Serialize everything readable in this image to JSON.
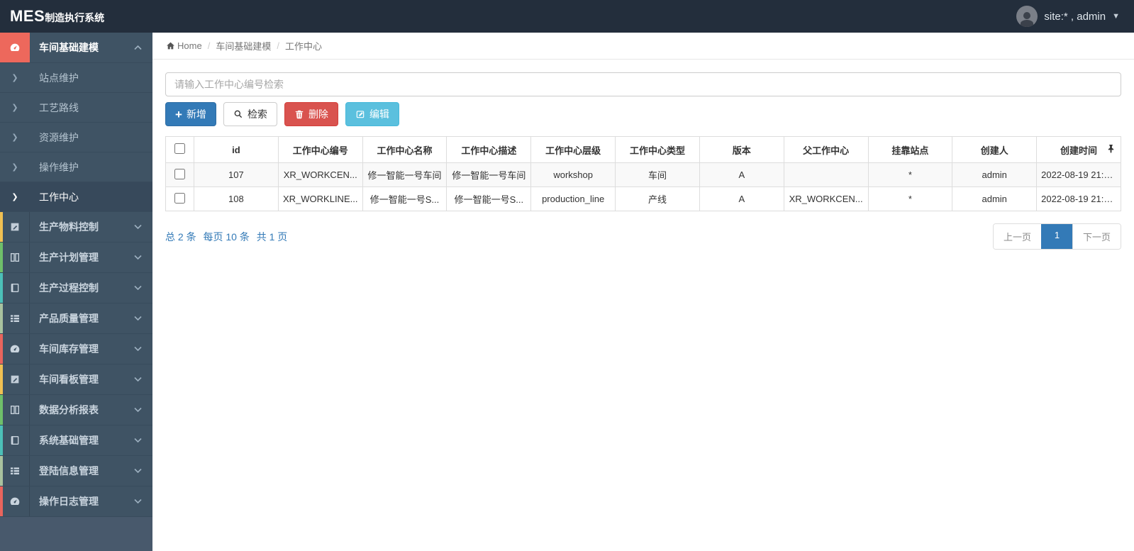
{
  "topbar": {
    "logo_mes": "MES",
    "logo_rest": "制造执行系统",
    "user_label": "site:* , admin"
  },
  "breadcrumb": {
    "home": "Home",
    "level1": "车间基础建模",
    "level2": "工作中心"
  },
  "sidebar": {
    "root": {
      "label": "车间基础建模",
      "icon": "dashboard-icon"
    },
    "sub_items": [
      {
        "label": "站点维护",
        "active": false
      },
      {
        "label": "工艺路线",
        "active": false
      },
      {
        "label": "资源维护",
        "active": false
      },
      {
        "label": "操作维护",
        "active": false
      },
      {
        "label": "工作中心",
        "active": true
      }
    ],
    "items": [
      {
        "label": "生产物料控制",
        "icon": "pencil-square-icon",
        "strip_color": "#f0c052"
      },
      {
        "label": "生产计划管理",
        "icon": "columns-icon",
        "strip_color": "#6fbf6a"
      },
      {
        "label": "生产过程控制",
        "icon": "book-icon",
        "strip_color": "#4cc0b8"
      },
      {
        "label": "产品质量管理",
        "icon": "th-list-icon",
        "strip_color": "#a9c29f"
      },
      {
        "label": "车间库存管理",
        "icon": "dashboard-icon",
        "strip_color": "#e9655d"
      },
      {
        "label": "车间看板管理",
        "icon": "pencil-square-icon",
        "strip_color": "#f0c052"
      },
      {
        "label": "数据分析报表",
        "icon": "columns-icon",
        "strip_color": "#6fbf6a"
      },
      {
        "label": "系统基础管理",
        "icon": "book-icon",
        "strip_color": "#4cc0b8"
      },
      {
        "label": "登陆信息管理",
        "icon": "th-list-icon",
        "strip_color": "#a9c29f"
      },
      {
        "label": "操作日志管理",
        "icon": "dashboard-icon",
        "strip_color": "#e9655d"
      }
    ]
  },
  "toolbar": {
    "search_placeholder": "请输入工作中心编号检索",
    "add_label": "新增",
    "search_label": "检索",
    "delete_label": "删除",
    "edit_label": "编辑"
  },
  "table": {
    "columns": [
      "id",
      "工作中心编号",
      "工作中心名称",
      "工作中心描述",
      "工作中心层级",
      "工作中心类型",
      "版本",
      "父工作中心",
      "挂靠站点",
      "创建人",
      "创建时间"
    ],
    "rows": [
      [
        "107",
        "XR_WORKCEN...",
        "修一智能一号车间",
        "修一智能一号车间",
        "workshop",
        "车间",
        "A",
        "",
        "*",
        "admin",
        "2022-08-19 21:1..."
      ],
      [
        "108",
        "XR_WORKLINE...",
        "修一智能一号S...",
        "修一智能一号S...",
        "production_line",
        "产线",
        "A",
        "XR_WORKCEN...",
        "*",
        "admin",
        "2022-08-19 21:1..."
      ]
    ]
  },
  "pagination": {
    "summary_total": "总 2 条",
    "summary_per_page": "每页 10 条",
    "summary_pages": "共 1 页",
    "prev_label": "上一页",
    "current_page": "1",
    "next_label": "下一页"
  },
  "colors": {
    "topbar_bg": "#232e3c",
    "sidebar_bg": "#48596c",
    "sidebar_item_bg": "#3f5364",
    "sidebar_active_bg": "#37495b",
    "root_icon_active_bg": "#ed685c",
    "primary_blue": "#337ab7",
    "danger_red": "#d9534f",
    "info_cyan": "#5bc0de",
    "link_blue": "#337ab7"
  }
}
